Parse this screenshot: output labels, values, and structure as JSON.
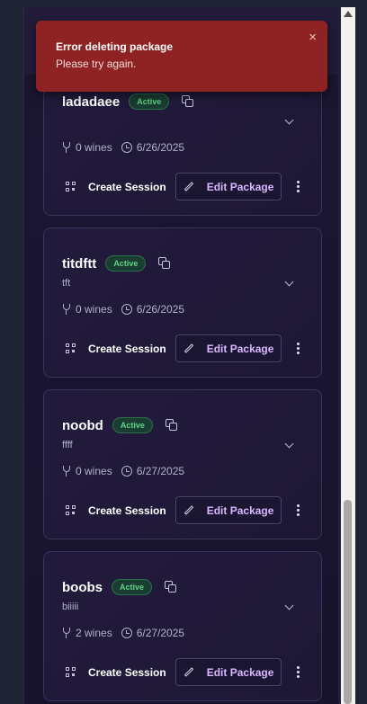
{
  "toast": {
    "title": "Error deleting package",
    "description": "Please try again.",
    "close_glyph": "×"
  },
  "status_color": "#5fd08a",
  "packages": [
    {
      "name": "ladadaee",
      "status": "Active",
      "description": "",
      "wines": "0 wines",
      "date": "6/26/2025",
      "create_label": "Create Session",
      "edit_label": "Edit Package"
    },
    {
      "name": "titdftt",
      "status": "Active",
      "description": "tft",
      "wines": "0 wines",
      "date": "6/26/2025",
      "create_label": "Create Session",
      "edit_label": "Edit Package"
    },
    {
      "name": "noobd",
      "status": "Active",
      "description": "ffff",
      "wines": "0 wines",
      "date": "6/27/2025",
      "create_label": "Create Session",
      "edit_label": "Edit Package"
    },
    {
      "name": "boobs",
      "status": "Active",
      "description": "biiiii",
      "wines": "2 wines",
      "date": "6/27/2025",
      "create_label": "Create Session",
      "edit_label": "Edit Package"
    }
  ]
}
